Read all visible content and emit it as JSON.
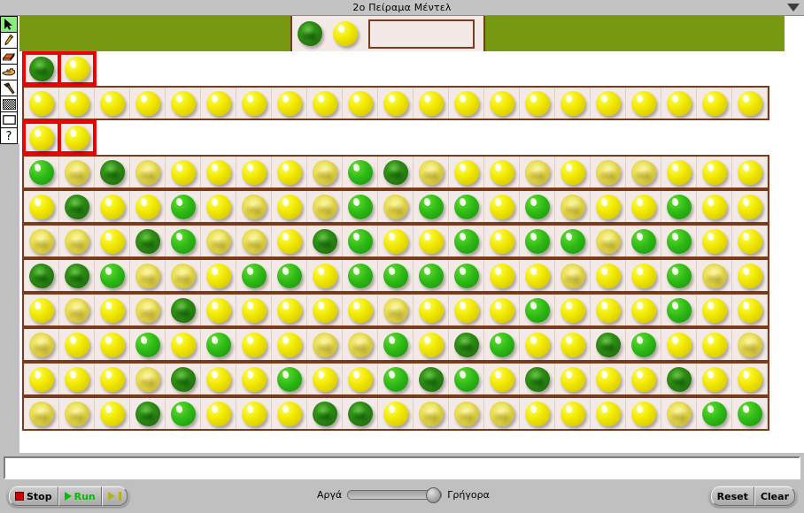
{
  "window": {
    "title": "2ο Πείραμα Μέντελ",
    "menu_icon": "chevron-down-icon"
  },
  "toolbar": {
    "tools": [
      {
        "name": "arrow-tool",
        "icon": "arrow-cursor-icon",
        "selected": true
      },
      {
        "name": "pencil-tool",
        "icon": "pencil-icon",
        "selected": false
      },
      {
        "name": "eraser-tool",
        "icon": "eraser-icon",
        "selected": false
      },
      {
        "name": "hand-tool",
        "icon": "pointing-hand-icon",
        "selected": false
      },
      {
        "name": "hammer-tool",
        "icon": "hammer-icon",
        "selected": false
      },
      {
        "name": "pattern-tool",
        "icon": "checkered-pattern-icon",
        "selected": false
      },
      {
        "name": "rectangle-tool",
        "icon": "rectangle-icon",
        "selected": false
      },
      {
        "name": "help-tool",
        "icon": "question-mark-icon",
        "selected": false
      }
    ]
  },
  "canvas": {
    "background_band_color": "#779911",
    "cell_background_color": "#f3e9e7",
    "cell_border_color": "#7a3b1c",
    "highlight_border_color": "#ee0000",
    "pea_legend": {
      "ys": "yellow-smooth-pea",
      "gs": "green-smooth-pea",
      "yw": "yellow-wrinkled-pea",
      "gw": "green-wrinkled-pea"
    },
    "parent_row": {
      "peas": [
        "gw",
        "ys"
      ],
      "empty_box": ""
    },
    "rows": [
      {
        "name": "row-parents",
        "highlighted_cells": 2,
        "partial": true,
        "peas": [
          "gw",
          "ys"
        ]
      },
      {
        "name": "row-f1",
        "highlighted_cells": 0,
        "partial": false,
        "peas": [
          "ys",
          "ys",
          "ys",
          "ys",
          "ys",
          "ys",
          "ys",
          "ys",
          "ys",
          "ys",
          "ys",
          "ys",
          "ys",
          "ys",
          "ys",
          "ys",
          "ys",
          "ys",
          "ys",
          "ys",
          "ys"
        ]
      },
      {
        "name": "row-selected-pair",
        "highlighted_cells": 2,
        "partial": true,
        "peas": [
          "ys",
          "ys"
        ]
      },
      {
        "name": "row-f2-1",
        "highlighted_cells": 0,
        "partial": false,
        "peas": [
          "gs",
          "yw",
          "gw",
          "yw",
          "ys",
          "ys",
          "ys",
          "ys",
          "yw",
          "gs",
          "gw",
          "yw",
          "ys",
          "ys",
          "yw",
          "ys",
          "yw",
          "yw",
          "ys",
          "ys",
          "ys"
        ]
      },
      {
        "name": "row-f2-2",
        "highlighted_cells": 0,
        "partial": false,
        "peas": [
          "ys",
          "gw",
          "ys",
          "ys",
          "gs",
          "ys",
          "yw",
          "ys",
          "yw",
          "gs",
          "yw",
          "gs",
          "gs",
          "ys",
          "gs",
          "yw",
          "ys",
          "ys",
          "gs",
          "ys",
          "ys"
        ]
      },
      {
        "name": "row-f2-3",
        "highlighted_cells": 0,
        "partial": false,
        "peas": [
          "yw",
          "yw",
          "ys",
          "gw",
          "gs",
          "yw",
          "yw",
          "ys",
          "gw",
          "gs",
          "ys",
          "ys",
          "gs",
          "ys",
          "gs",
          "gs",
          "yw",
          "gs",
          "gs",
          "ys",
          "ys"
        ]
      },
      {
        "name": "row-f2-4",
        "highlighted_cells": 0,
        "partial": false,
        "peas": [
          "gw",
          "gw",
          "gs",
          "yw",
          "yw",
          "ys",
          "gs",
          "gs",
          "ys",
          "gs",
          "gs",
          "gs",
          "gs",
          "ys",
          "ys",
          "yw",
          "ys",
          "ys",
          "gs",
          "yw",
          "ys"
        ]
      },
      {
        "name": "row-f2-5",
        "highlighted_cells": 0,
        "partial": false,
        "peas": [
          "ys",
          "yw",
          "ys",
          "yw",
          "gw",
          "ys",
          "ys",
          "ys",
          "ys",
          "ys",
          "yw",
          "ys",
          "ys",
          "ys",
          "gs",
          "ys",
          "ys",
          "ys",
          "gs",
          "ys",
          "ys"
        ]
      },
      {
        "name": "row-f2-6",
        "highlighted_cells": 0,
        "partial": false,
        "peas": [
          "yw",
          "ys",
          "ys",
          "gs",
          "ys",
          "gs",
          "ys",
          "ys",
          "yw",
          "yw",
          "gs",
          "ys",
          "gw",
          "gs",
          "ys",
          "ys",
          "gw",
          "gs",
          "ys",
          "ys",
          "yw"
        ]
      },
      {
        "name": "row-f2-7",
        "highlighted_cells": 0,
        "partial": false,
        "peas": [
          "ys",
          "ys",
          "ys",
          "yw",
          "gw",
          "ys",
          "ys",
          "gs",
          "ys",
          "ys",
          "gs",
          "gw",
          "gs",
          "ys",
          "gw",
          "ys",
          "ys",
          "ys",
          "gw",
          "ys",
          "ys"
        ]
      },
      {
        "name": "row-f2-8",
        "highlighted_cells": 0,
        "partial": false,
        "peas": [
          "yw",
          "yw",
          "ys",
          "gw",
          "gs",
          "ys",
          "ys",
          "ys",
          "gw",
          "gw",
          "ys",
          "yw",
          "yw",
          "yw",
          "ys",
          "ys",
          "ys",
          "ys",
          "yw",
          "gs",
          "gs"
        ]
      }
    ]
  },
  "message_field": {
    "value": "",
    "placeholder": ""
  },
  "controls": {
    "stop_label": "Stop",
    "run_label": "Run",
    "step_label": "",
    "slow_label": "Αργά",
    "fast_label": "Γρήγορα",
    "slider_value": 84,
    "reset_label": "Reset",
    "clear_label": "Clear",
    "run_color": "#00c000",
    "stop_color": "#cc0000"
  }
}
